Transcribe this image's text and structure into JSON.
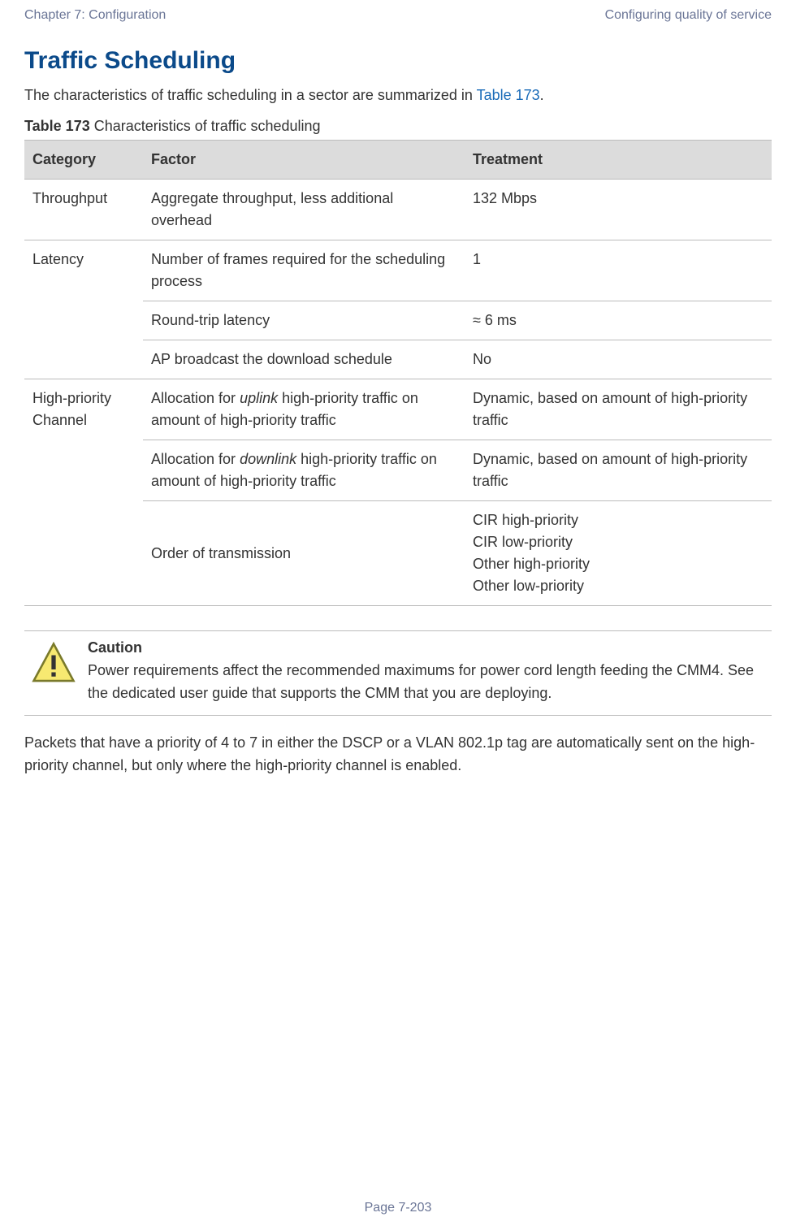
{
  "header": {
    "left": "Chapter 7:  Configuration",
    "right": "Configuring quality of service"
  },
  "title": "Traffic Scheduling",
  "intro": {
    "before_link": "The characteristics of traffic scheduling in a sector are summarized in ",
    "link_text": "Table 173",
    "after_link": "."
  },
  "table_caption": {
    "bold": "Table 173",
    "rest": " Characteristics of traffic scheduling"
  },
  "table_headers": {
    "c1": "Category",
    "c2": "Factor",
    "c3": "Treatment"
  },
  "rows": {
    "throughput": {
      "category": "Throughput",
      "factor": "Aggregate throughput, less additional overhead",
      "treatment": "132 Mbps"
    },
    "latency": {
      "category": "Latency",
      "r1": {
        "factor": "Number of frames required for the scheduling process",
        "treatment": "1"
      },
      "r2": {
        "factor": "Round-trip latency",
        "treatment": "≈ 6 ms"
      },
      "r3": {
        "factor": "AP broadcast the download schedule",
        "treatment": "No"
      }
    },
    "hp": {
      "category": "High-priority Channel",
      "r1": {
        "factor_pre": "Allocation for ",
        "factor_em": "uplink",
        "factor_post": " high-priority traffic on amount of high-priority traffic",
        "treatment": "Dynamic, based on amount of high-priority traffic"
      },
      "r2": {
        "factor_pre": "Allocation for ",
        "factor_em": "downlink",
        "factor_post": " high-priority traffic on amount of high-priority traffic",
        "treatment": "Dynamic, based on amount of high-priority traffic"
      },
      "r3": {
        "factor": "Order of transmission",
        "t1": "CIR high-priority",
        "t2": "CIR low-priority",
        "t3": "Other high-priority",
        "t4": "Other low-priority"
      }
    }
  },
  "callout": {
    "title": "Caution",
    "body": "Power requirements affect the recommended maximums for power cord length feeding the CMM4. See the dedicated user guide that supports the CMM that you are deploying."
  },
  "after_text": "Packets that have a priority of 4 to 7 in either the DSCP or a VLAN 802.1p tag are automatically sent on the high-priority channel, but only where the high-priority channel is enabled.",
  "footer": "Page 7-203"
}
